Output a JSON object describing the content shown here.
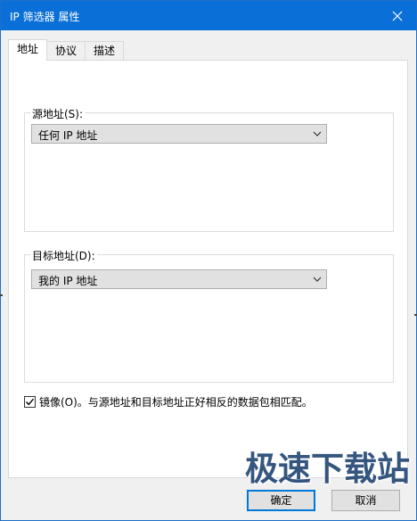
{
  "window": {
    "title": "IP 筛选器 属性",
    "close_icon": "close-icon"
  },
  "tabs": [
    {
      "label": "地址",
      "active": true
    },
    {
      "label": "协议",
      "active": false
    },
    {
      "label": "描述",
      "active": false
    }
  ],
  "source_group": {
    "label": "源地址(S):",
    "selected": "任何 IP 地址"
  },
  "dest_group": {
    "label": "目标地址(D):",
    "selected": "我的 IP 地址"
  },
  "mirror": {
    "label": "镜像(O)。与源地址和目标地址正好相反的数据包相匹配。",
    "checked": true
  },
  "buttons": {
    "ok": "确定",
    "cancel": "取消"
  },
  "watermark": "极速下载站",
  "colors": {
    "titlebar": "#0a6fd6",
    "accent": "#0078d7"
  }
}
